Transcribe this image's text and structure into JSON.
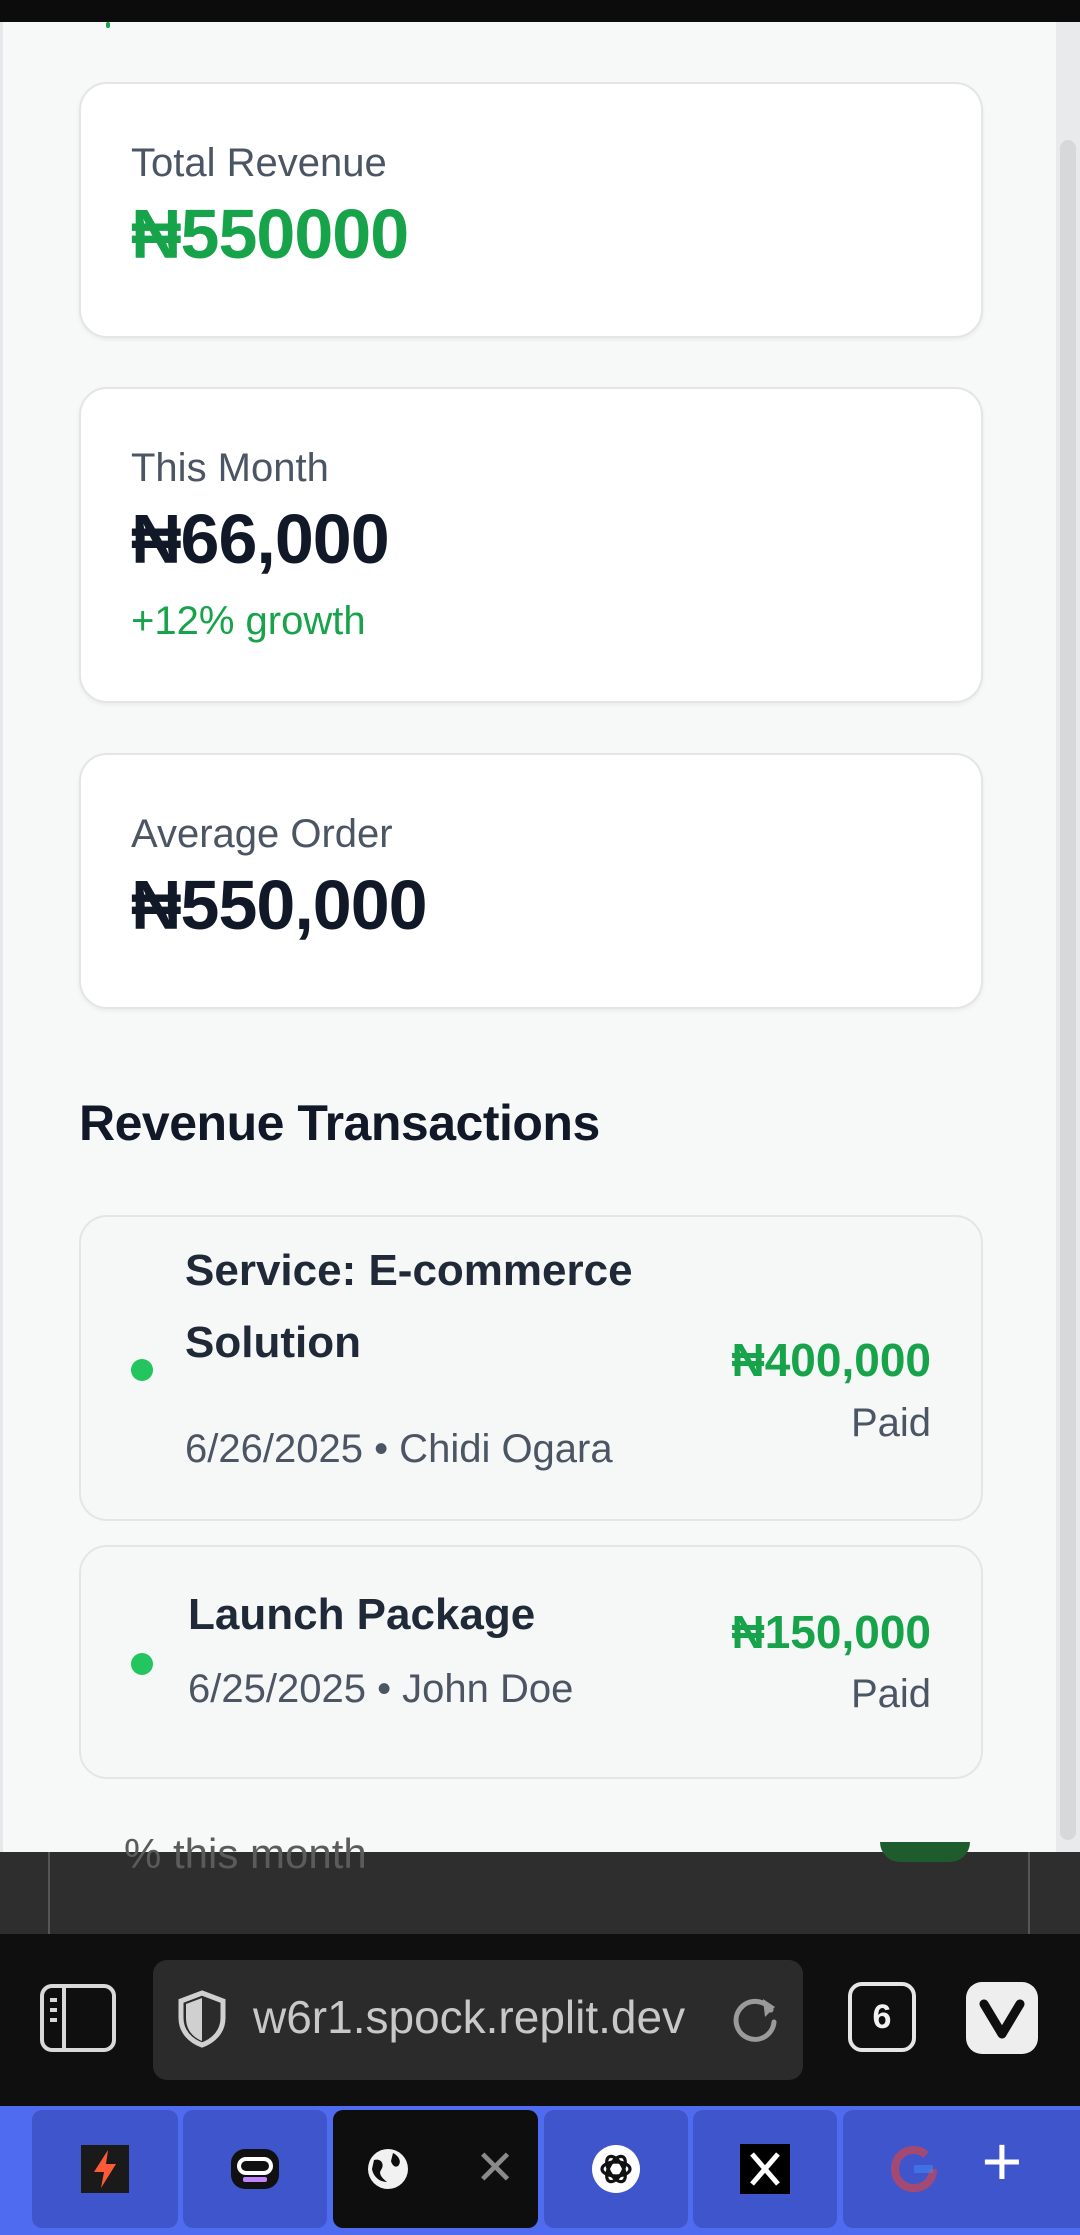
{
  "colors": {
    "accent_green": "#16a34a",
    "status_dot": "#22c55e",
    "tab_strip": "#4f6bef"
  },
  "stats": {
    "total_revenue": {
      "label": "Total Revenue",
      "value": "₦550000"
    },
    "this_month": {
      "label": "This Month",
      "value": "₦66,000",
      "note": "+12% growth"
    },
    "average_order": {
      "label": "Average Order",
      "value": "₦550,000"
    }
  },
  "transactions": {
    "title": "Revenue Transactions",
    "items": [
      {
        "name_line1": "Service: E-commerce",
        "name_line2": "Solution",
        "meta": "6/26/2025 • Chidi Ogara",
        "amount": "₦400,000",
        "status": "Paid"
      },
      {
        "name_line1": "Launch Package",
        "meta": "6/25/2025 • John Doe",
        "amount": "₦150,000",
        "status": "Paid"
      }
    ]
  },
  "underlay": {
    "text": "% this month"
  },
  "browser": {
    "url": "w6r1.spock.replit.dev",
    "tab_count": "6",
    "tabs": [
      {
        "icon": "lightning-app-icon"
      },
      {
        "icon": "bot-icon"
      },
      {
        "icon": "globe-icon",
        "active": true
      },
      {
        "icon": "openai-icon"
      },
      {
        "icon": "x-logo-icon"
      },
      {
        "icon": "google-icon"
      }
    ],
    "add_tab_label": "+"
  }
}
